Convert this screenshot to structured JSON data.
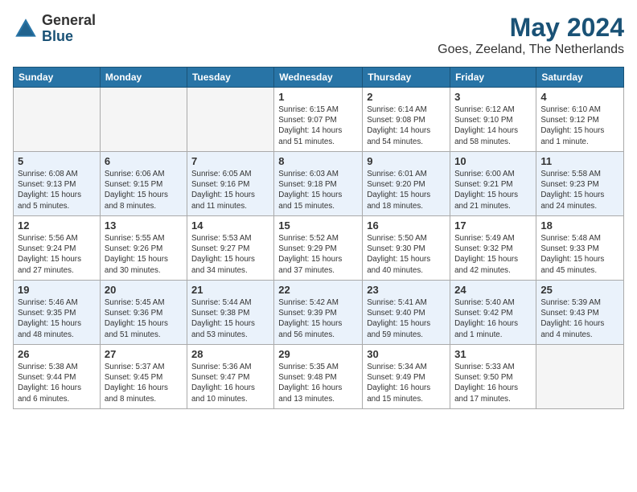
{
  "header": {
    "logo_general": "General",
    "logo_blue": "Blue",
    "month_title": "May 2024",
    "location": "Goes, Zeeland, The Netherlands"
  },
  "weekdays": [
    "Sunday",
    "Monday",
    "Tuesday",
    "Wednesday",
    "Thursday",
    "Friday",
    "Saturday"
  ],
  "weeks": [
    [
      {
        "day": "",
        "info": ""
      },
      {
        "day": "",
        "info": ""
      },
      {
        "day": "",
        "info": ""
      },
      {
        "day": "1",
        "info": "Sunrise: 6:15 AM\nSunset: 9:07 PM\nDaylight: 14 hours\nand 51 minutes."
      },
      {
        "day": "2",
        "info": "Sunrise: 6:14 AM\nSunset: 9:08 PM\nDaylight: 14 hours\nand 54 minutes."
      },
      {
        "day": "3",
        "info": "Sunrise: 6:12 AM\nSunset: 9:10 PM\nDaylight: 14 hours\nand 58 minutes."
      },
      {
        "day": "4",
        "info": "Sunrise: 6:10 AM\nSunset: 9:12 PM\nDaylight: 15 hours\nand 1 minute."
      }
    ],
    [
      {
        "day": "5",
        "info": "Sunrise: 6:08 AM\nSunset: 9:13 PM\nDaylight: 15 hours\nand 5 minutes."
      },
      {
        "day": "6",
        "info": "Sunrise: 6:06 AM\nSunset: 9:15 PM\nDaylight: 15 hours\nand 8 minutes."
      },
      {
        "day": "7",
        "info": "Sunrise: 6:05 AM\nSunset: 9:16 PM\nDaylight: 15 hours\nand 11 minutes."
      },
      {
        "day": "8",
        "info": "Sunrise: 6:03 AM\nSunset: 9:18 PM\nDaylight: 15 hours\nand 15 minutes."
      },
      {
        "day": "9",
        "info": "Sunrise: 6:01 AM\nSunset: 9:20 PM\nDaylight: 15 hours\nand 18 minutes."
      },
      {
        "day": "10",
        "info": "Sunrise: 6:00 AM\nSunset: 9:21 PM\nDaylight: 15 hours\nand 21 minutes."
      },
      {
        "day": "11",
        "info": "Sunrise: 5:58 AM\nSunset: 9:23 PM\nDaylight: 15 hours\nand 24 minutes."
      }
    ],
    [
      {
        "day": "12",
        "info": "Sunrise: 5:56 AM\nSunset: 9:24 PM\nDaylight: 15 hours\nand 27 minutes."
      },
      {
        "day": "13",
        "info": "Sunrise: 5:55 AM\nSunset: 9:26 PM\nDaylight: 15 hours\nand 30 minutes."
      },
      {
        "day": "14",
        "info": "Sunrise: 5:53 AM\nSunset: 9:27 PM\nDaylight: 15 hours\nand 34 minutes."
      },
      {
        "day": "15",
        "info": "Sunrise: 5:52 AM\nSunset: 9:29 PM\nDaylight: 15 hours\nand 37 minutes."
      },
      {
        "day": "16",
        "info": "Sunrise: 5:50 AM\nSunset: 9:30 PM\nDaylight: 15 hours\nand 40 minutes."
      },
      {
        "day": "17",
        "info": "Sunrise: 5:49 AM\nSunset: 9:32 PM\nDaylight: 15 hours\nand 42 minutes."
      },
      {
        "day": "18",
        "info": "Sunrise: 5:48 AM\nSunset: 9:33 PM\nDaylight: 15 hours\nand 45 minutes."
      }
    ],
    [
      {
        "day": "19",
        "info": "Sunrise: 5:46 AM\nSunset: 9:35 PM\nDaylight: 15 hours\nand 48 minutes."
      },
      {
        "day": "20",
        "info": "Sunrise: 5:45 AM\nSunset: 9:36 PM\nDaylight: 15 hours\nand 51 minutes."
      },
      {
        "day": "21",
        "info": "Sunrise: 5:44 AM\nSunset: 9:38 PM\nDaylight: 15 hours\nand 53 minutes."
      },
      {
        "day": "22",
        "info": "Sunrise: 5:42 AM\nSunset: 9:39 PM\nDaylight: 15 hours\nand 56 minutes."
      },
      {
        "day": "23",
        "info": "Sunrise: 5:41 AM\nSunset: 9:40 PM\nDaylight: 15 hours\nand 59 minutes."
      },
      {
        "day": "24",
        "info": "Sunrise: 5:40 AM\nSunset: 9:42 PM\nDaylight: 16 hours\nand 1 minute."
      },
      {
        "day": "25",
        "info": "Sunrise: 5:39 AM\nSunset: 9:43 PM\nDaylight: 16 hours\nand 4 minutes."
      }
    ],
    [
      {
        "day": "26",
        "info": "Sunrise: 5:38 AM\nSunset: 9:44 PM\nDaylight: 16 hours\nand 6 minutes."
      },
      {
        "day": "27",
        "info": "Sunrise: 5:37 AM\nSunset: 9:45 PM\nDaylight: 16 hours\nand 8 minutes."
      },
      {
        "day": "28",
        "info": "Sunrise: 5:36 AM\nSunset: 9:47 PM\nDaylight: 16 hours\nand 10 minutes."
      },
      {
        "day": "29",
        "info": "Sunrise: 5:35 AM\nSunset: 9:48 PM\nDaylight: 16 hours\nand 13 minutes."
      },
      {
        "day": "30",
        "info": "Sunrise: 5:34 AM\nSunset: 9:49 PM\nDaylight: 16 hours\nand 15 minutes."
      },
      {
        "day": "31",
        "info": "Sunrise: 5:33 AM\nSunset: 9:50 PM\nDaylight: 16 hours\nand 17 minutes."
      },
      {
        "day": "",
        "info": ""
      }
    ]
  ]
}
